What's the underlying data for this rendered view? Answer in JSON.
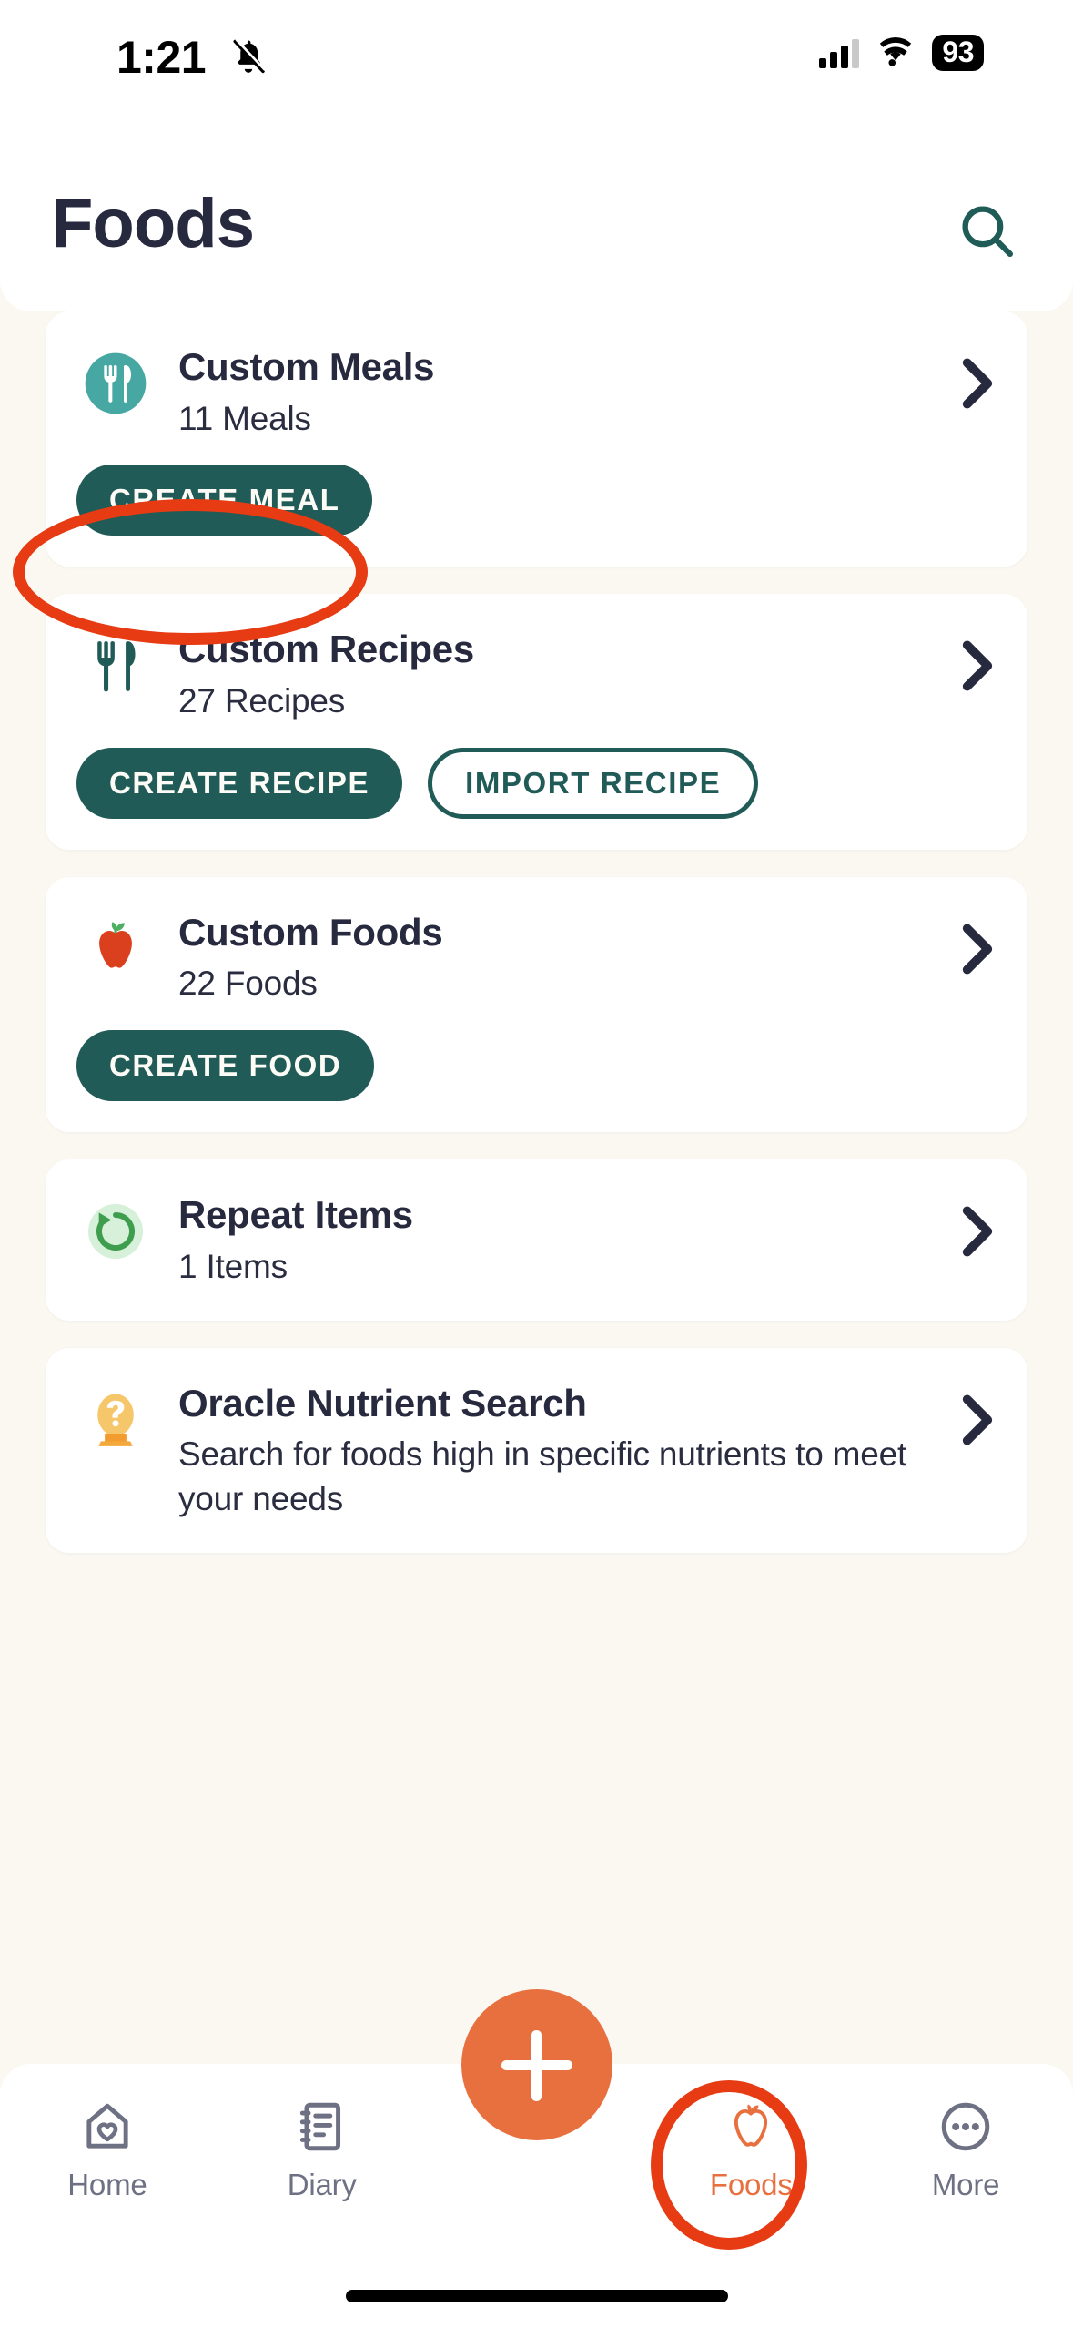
{
  "status_bar": {
    "time": "1:21",
    "silent_icon": "bell-slash-icon",
    "cellular_icon": "cellular-signal-icon",
    "wifi_icon": "wifi-icon",
    "battery_level": "93"
  },
  "header": {
    "title": "Foods",
    "search_icon": "search-icon"
  },
  "cards": [
    {
      "icon": "fork-knife-plate-icon",
      "title": "Custom Meals",
      "subtitle": "11 Meals",
      "chevron": "chevron-right-icon",
      "actions": [
        {
          "label": "CREATE MEAL",
          "style": "filled"
        }
      ]
    },
    {
      "icon": "fork-knife-icon",
      "title": "Custom Recipes",
      "subtitle": "27 Recipes",
      "chevron": "chevron-right-icon",
      "actions": [
        {
          "label": "CREATE RECIPE",
          "style": "filled"
        },
        {
          "label": "IMPORT RECIPE",
          "style": "outline"
        }
      ]
    },
    {
      "icon": "apple-icon",
      "title": "Custom Foods",
      "subtitle": "22 Foods",
      "chevron": "chevron-right-icon",
      "actions": [
        {
          "label": "CREATE FOOD",
          "style": "filled"
        }
      ]
    },
    {
      "icon": "repeat-circular-arrow-icon",
      "title": "Repeat Items",
      "subtitle": "1 Items",
      "chevron": "chevron-right-icon",
      "actions": []
    },
    {
      "icon": "oracle-crystal-ball-icon",
      "title": "Oracle Nutrient Search",
      "subtitle": "Search for foods high in specific nutrients to meet your needs",
      "chevron": "chevron-right-icon",
      "actions": []
    }
  ],
  "fab": {
    "icon": "plus-icon",
    "label": "Add"
  },
  "bottom_nav": {
    "tabs": [
      {
        "label": "Home",
        "icon": "home-heart-icon",
        "active": false
      },
      {
        "label": "Diary",
        "icon": "notebook-icon",
        "active": false
      },
      {
        "label": "Foods",
        "icon": "apple-outline-icon",
        "active": true
      },
      {
        "label": "More",
        "icon": "ellipsis-circle-icon",
        "active": false
      }
    ]
  },
  "annotations": [
    {
      "target": "CREATE MEAL",
      "shape": "ellipse",
      "color": "#E63B13"
    },
    {
      "target": "Foods tab",
      "shape": "ellipse",
      "color": "#E63B13"
    }
  ],
  "colors": {
    "page_background": "#FAF8F1",
    "card_background": "#FFFFFF",
    "primary_teal": "#205B57",
    "accent_orange": "#E8703F",
    "annotation_red": "#E63B13",
    "text_dark": "#272A3E",
    "nav_inactive": "#6E7183"
  }
}
